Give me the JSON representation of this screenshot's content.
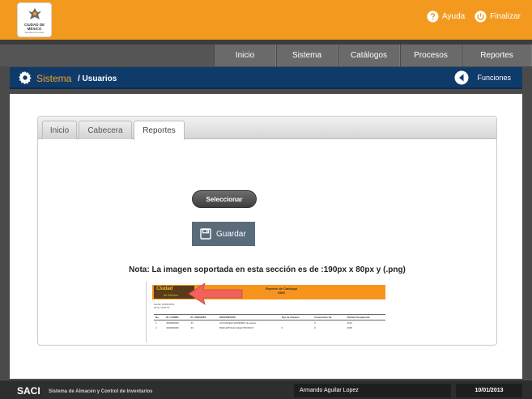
{
  "header": {
    "logo": {
      "text": "CIUDAD DE MÉXICO",
      "subtext": "Decidiendo juntos"
    },
    "actions": [
      {
        "label": "Ayuda",
        "icon": "help-icon"
      },
      {
        "label": "Finalizar",
        "icon": "power-icon"
      }
    ]
  },
  "nav": {
    "items": [
      {
        "label": "Inicio"
      },
      {
        "label": "Sistema"
      },
      {
        "label": "Catálogos"
      },
      {
        "label": "Procesos"
      },
      {
        "label": "Reportes"
      }
    ]
  },
  "section": {
    "title": "Sistema",
    "subtitle": "/ Usuarios",
    "functions_label": "Funciones"
  },
  "tabs": [
    {
      "label": "Inicio"
    },
    {
      "label": "Cabecera"
    },
    {
      "label": "Reportes"
    }
  ],
  "active_tab": "Reportes",
  "form": {
    "select_label": "Seleccionar",
    "save_label": "Guardar",
    "note": "Nota: La imagen soportada en esta sección es de :190px x 80px y (.png)"
  },
  "preview": {
    "logo_text": "Ciudad",
    "logo_sub": "de México",
    "title": "Reporte de Catálogo",
    "title2": "DMS",
    "meta": [
      "Fecha: 10/01/2013",
      "Hora: 10:07:47"
    ],
    "columns": [
      "No.",
      "ID. CARRIO",
      "ID. UNIDADES",
      "DESCRIPCION",
      "Tipo de Almacen",
      "Consecutivo No.",
      "Partida Presupuestal"
    ],
    "rows": [
      [
        "1",
        "3000000000",
        "33",
        "ACCANCELO EXPENDIT de equipo",
        "",
        "0",
        "2012"
      ],
      [
        "2",
        "3330000000",
        "33",
        "BIEN ARTICULO ELECTRONICO",
        "0",
        "0",
        "2008"
      ]
    ]
  },
  "footer": {
    "brand": "SACI",
    "description": "Sistema de Almacén y Control de Inventarios",
    "user": "Armando Aguilar Lopez",
    "date": "10/01/2013"
  },
  "colors": {
    "header_orange": "#f39a1e",
    "nav_gray": "#555555",
    "section_blue": "#0f3b6b",
    "accent_orange": "#f5a21f",
    "footer_dark": "#2e2e2e",
    "arrow_red": "#f0625a"
  }
}
